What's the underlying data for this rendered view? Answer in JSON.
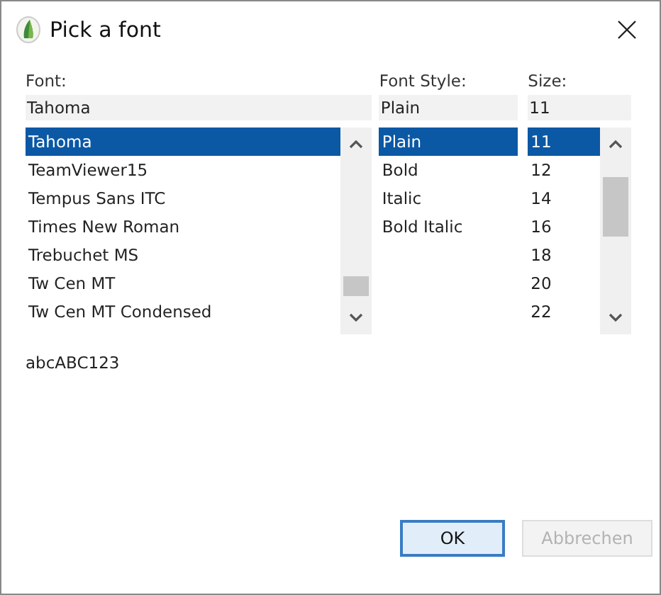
{
  "window": {
    "title": "Pick a font"
  },
  "font": {
    "label": "Font:",
    "value": "Tahoma",
    "items": [
      {
        "label": "Tahoma",
        "selected": true
      },
      {
        "label": "TeamViewer15",
        "selected": false
      },
      {
        "label": "Tempus Sans ITC",
        "selected": false
      },
      {
        "label": "Times New Roman",
        "selected": false
      },
      {
        "label": "Trebuchet MS",
        "selected": false
      },
      {
        "label": "Tw Cen MT",
        "selected": false
      },
      {
        "label": "Tw Cen MT Condensed",
        "selected": false
      }
    ]
  },
  "style": {
    "label": "Font Style:",
    "value": "Plain",
    "items": [
      {
        "label": "Plain",
        "selected": true
      },
      {
        "label": "Bold",
        "selected": false
      },
      {
        "label": "Italic",
        "selected": false
      },
      {
        "label": "Bold Italic",
        "selected": false
      }
    ]
  },
  "size": {
    "label": "Size:",
    "value": "11",
    "items": [
      {
        "label": "11",
        "selected": true
      },
      {
        "label": "12",
        "selected": false
      },
      {
        "label": "14",
        "selected": false
      },
      {
        "label": "16",
        "selected": false
      },
      {
        "label": "18",
        "selected": false
      },
      {
        "label": "20",
        "selected": false
      },
      {
        "label": "22",
        "selected": false
      }
    ]
  },
  "sample": "abcABC123",
  "buttons": [
    {
      "label": "OK",
      "disabled": false
    },
    {
      "label": "Abbrechen",
      "disabled": true
    }
  ]
}
